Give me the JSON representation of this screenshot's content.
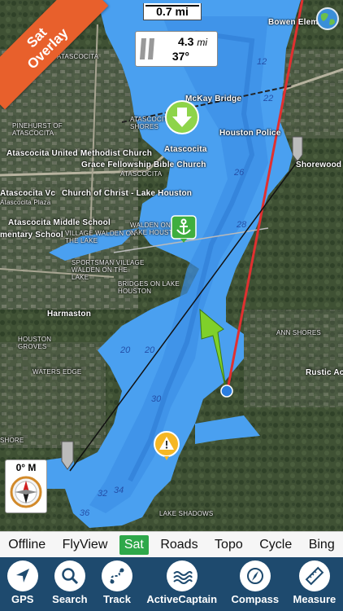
{
  "overlay_badge": {
    "line1": "Sat",
    "line2": "Overlay",
    "color": "#e8602c"
  },
  "scale": {
    "label": "0.7 mi"
  },
  "nav_info": {
    "distance_value": "4.3",
    "distance_unit": "mi",
    "bearing": "37°"
  },
  "compass_widget": {
    "label": "0° M"
  },
  "place_labels": [
    "ATASCOCITA",
    "ATASCOCITA SHORES",
    "McKay Bridge",
    "Bowen Elem",
    "PINEHURST OF ATASCOCITA",
    "Atascocita United Methodist Church",
    "Atascocita",
    "Houston Police",
    "Grace Fellowship Bible Church",
    "ATASCOCITA",
    "Shorewood",
    "Atascocita Vc",
    "Church of Christ - Lake Houston",
    "Atascocita Plaza",
    "Atascocita Middle School",
    "WALDEN ON LAKE HOUSTON",
    "mentary School",
    "VILLAGE WALDEN ON THE LAKE",
    "SPORTSMAN VILLAGE WALDEN ON THE LAKE",
    "BRIDGES ON LAKE HOUSTON",
    "Harmaston",
    "HOUSTON GROVES",
    "ANN SHORES",
    "WATERS EDGE",
    "Rustic Ac",
    "SHORE",
    "LAKE SHADOWS"
  ],
  "depth_labels": [
    "12",
    "22",
    "26",
    "28",
    "20",
    "20",
    "30",
    "32",
    "34",
    "36"
  ],
  "map_tabs": [
    "Offline",
    "FlyView",
    "Sat",
    "Roads",
    "Topo",
    "Cycle",
    "Bing"
  ],
  "active_tab": "Sat",
  "toolbar": [
    "GPS",
    "Search",
    "Track",
    "ActiveCaptain",
    "Compass",
    "Measure"
  ],
  "colors": {
    "water": "#4aa0f0",
    "route_line": "#e03030",
    "toolbar_bg": "#1e4a6e",
    "active_tab": "#2ea84a"
  }
}
